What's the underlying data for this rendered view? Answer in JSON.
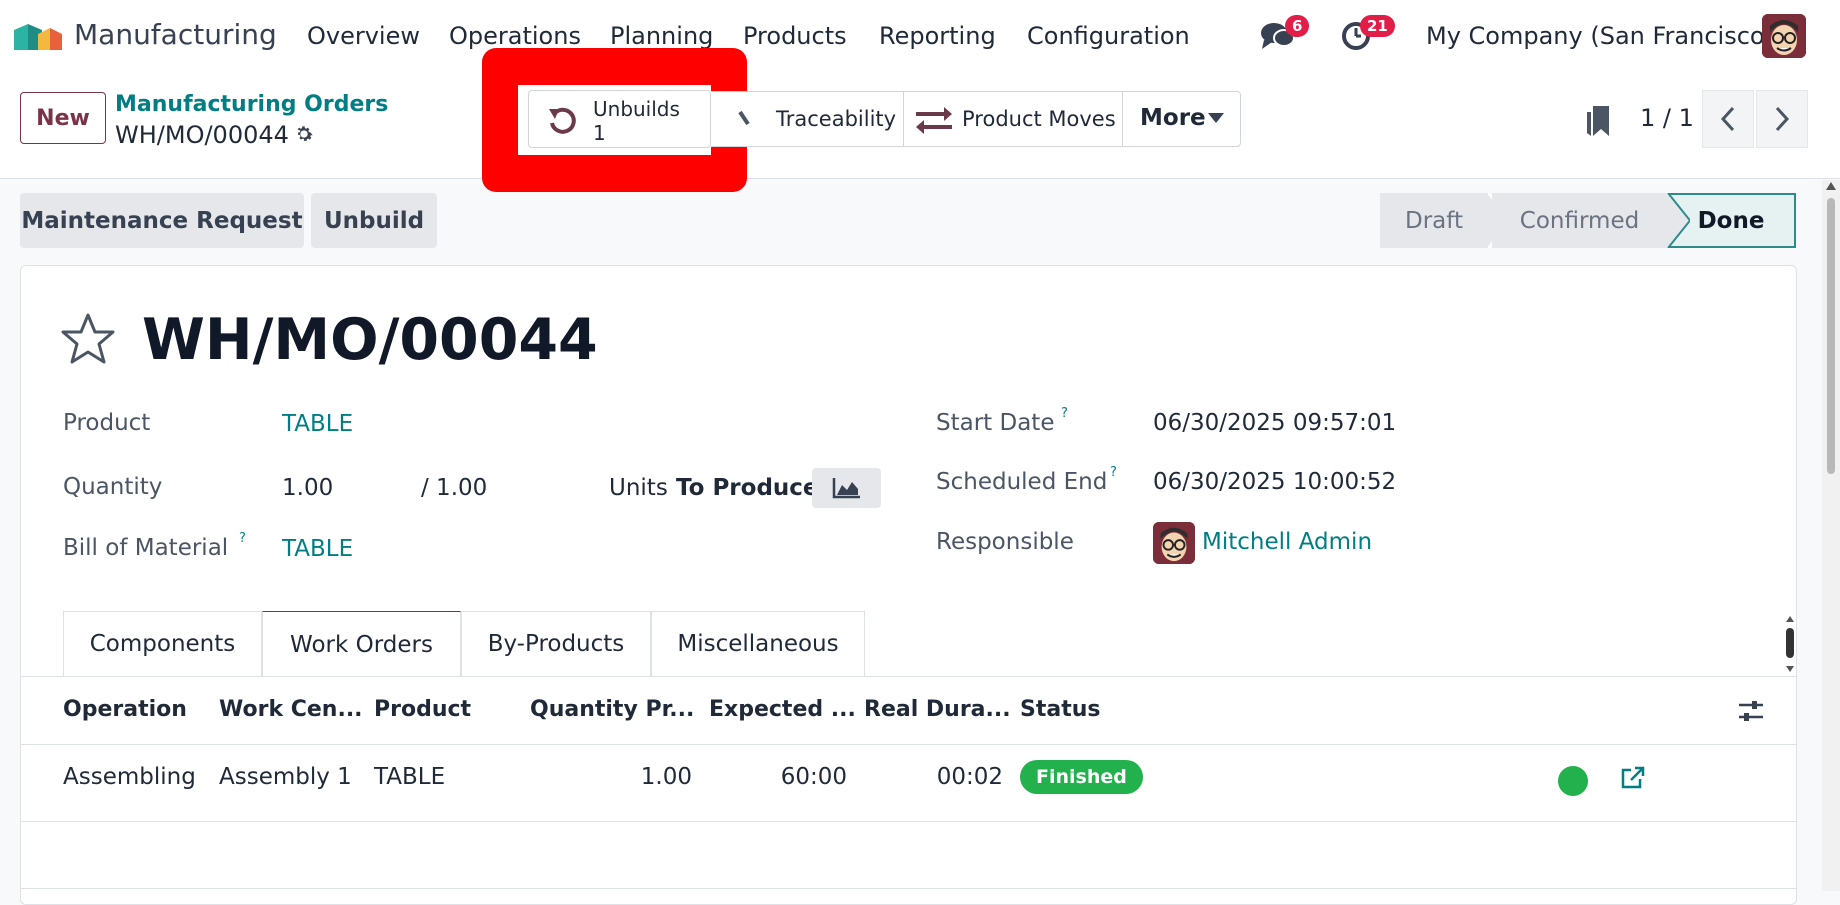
{
  "app": {
    "name": "Manufacturing"
  },
  "menu": {
    "overview": "Overview",
    "operations": "Operations",
    "planning": "Planning",
    "products": "Products",
    "reporting": "Reporting",
    "configuration": "Configuration"
  },
  "systray": {
    "messages_count": "6",
    "activities_count": "21",
    "company": "My Company (San Francisco)"
  },
  "control": {
    "new_label": "New",
    "breadcrumb": "Manufacturing Orders",
    "record": "WH/MO/00044",
    "smart_buttons": {
      "unbuilds_label": "Unbuilds",
      "unbuilds_count": "1",
      "traceability": "Traceability",
      "product_moves": "Product Moves",
      "more": "More"
    },
    "pager": "1 / 1"
  },
  "actions": {
    "maintenance": "Maintenance Request",
    "unbuild": "Unbuild"
  },
  "statusbar": [
    "Draft",
    "Confirmed",
    "Done"
  ],
  "form": {
    "title": "WH/MO/00044",
    "product_label": "Product",
    "product_value": "TABLE",
    "quantity_label": "Quantity",
    "quantity_value": "1.00",
    "quantity_total": "/ 1.00",
    "units_label": "Units",
    "to_produce": "To Produce",
    "bom_label": "Bill of Material",
    "bom_value": "TABLE",
    "start_label": "Start Date",
    "start_value": "06/30/2025 09:57:01",
    "end_label": "Scheduled End",
    "end_value": "06/30/2025 10:00:52",
    "resp_label": "Responsible",
    "resp_value": "Mitchell Admin",
    "help_mark": "?"
  },
  "tabs": [
    "Components",
    "Work Orders",
    "By-Products",
    "Miscellaneous"
  ],
  "table": {
    "headers": [
      "Operation",
      "Work Cen...",
      "Product",
      "Quantity Pr...",
      "Expected ...",
      "Real Dura...",
      "Status"
    ],
    "row": {
      "operation": "Assembling",
      "work_center": "Assembly 1",
      "product": "TABLE",
      "quantity": "1.00",
      "expected": "60:00",
      "real": "00:02",
      "status": "Finished"
    }
  }
}
